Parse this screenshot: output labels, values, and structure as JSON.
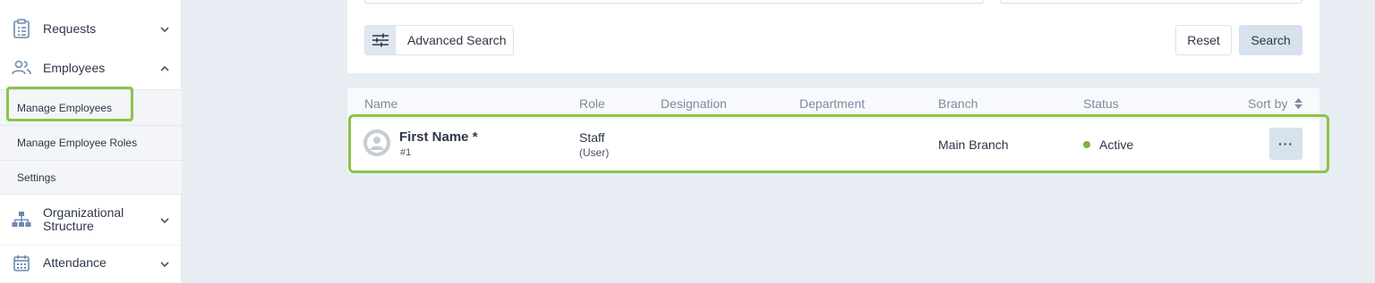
{
  "sidebar": {
    "items": [
      {
        "label": "Requests",
        "icon": "clipboard-icon"
      },
      {
        "label": "Employees",
        "icon": "users-icon"
      },
      {
        "label": "Organizational Structure",
        "icon": "org-chart-icon"
      },
      {
        "label": "Attendance",
        "icon": "calendar-icon"
      }
    ],
    "employees_sub": [
      {
        "label": "Manage Employees"
      },
      {
        "label": "Manage Employee Roles"
      },
      {
        "label": "Settings"
      }
    ]
  },
  "filters": {
    "advanced_search_label": "Advanced Search",
    "reset_label": "Reset",
    "search_label": "Search"
  },
  "table": {
    "columns": [
      "Name",
      "Role",
      "Designation",
      "Department",
      "Branch",
      "Status"
    ],
    "sort_label": "Sort by",
    "rows": [
      {
        "name": "First Name *",
        "id": "#1",
        "role": "Staff",
        "role_sub": "(User)",
        "designation": "",
        "department": "",
        "branch": "Main Branch",
        "status": "Active",
        "more": "···"
      }
    ]
  },
  "colors": {
    "accent_highlight": "#8bc34a",
    "status_active": "#7cb342",
    "button_blue": "#d7e2ee",
    "background": "#e8edf4"
  }
}
